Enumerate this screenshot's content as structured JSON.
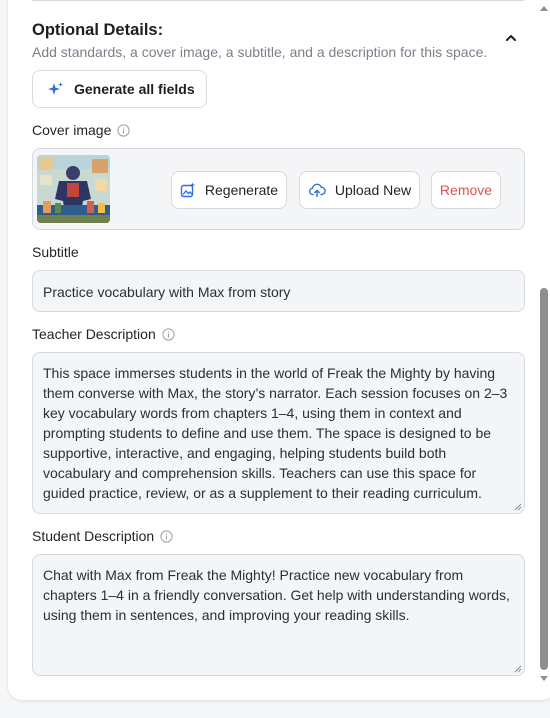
{
  "optional_details": {
    "title": "Optional Details:",
    "subtitle": "Add standards, a cover image, a subtitle, and a description for this space."
  },
  "generate_button": {
    "label": "Generate all fields"
  },
  "cover_image": {
    "label": "Cover image",
    "regenerate_label": "Regenerate",
    "upload_label": "Upload New",
    "remove_label": "Remove"
  },
  "subtitle_field": {
    "label": "Subtitle",
    "value": "Practice vocabulary with Max from story"
  },
  "teacher_description": {
    "label": "Teacher Description",
    "lines": [
      "This space immerses students in the world of Freak the Mighty by having",
      "them converse with Max, the story’s narrator. Each session focuses on 2–3",
      "key vocabulary words from chapters 1–4, using them in context and",
      "prompting students to define and use them. The space is designed to be",
      "supportive, interactive, and engaging, helping students build both",
      "vocabulary and comprehension skills. Teachers can use this space for",
      "guided practice, review, or as a supplement to their reading curriculum."
    ]
  },
  "student_description": {
    "label": "Student Description",
    "lines": [
      "Chat with Max from Freak the Mighty! Practice new vocabulary from",
      "chapters 1–4 in a friendly conversation. Get help with understanding words,",
      "using them in sentences, and improving your reading skills."
    ]
  },
  "colors": {
    "accent_blue": "#2f6fde",
    "remove_red": "#d9534f",
    "field_bg": "#f4f5f7",
    "border": "#d6d9de"
  },
  "icons": {
    "collapse": "chevron-up-icon",
    "generate": "sparkle-icon",
    "info": "info-icon",
    "regenerate": "image-sparkle-icon",
    "upload": "cloud-upload-icon"
  }
}
